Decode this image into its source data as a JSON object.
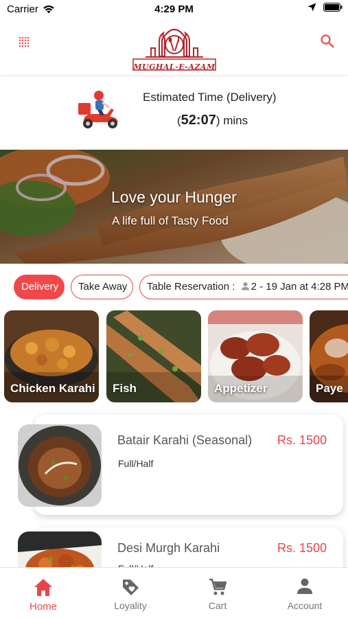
{
  "status_bar": {
    "carrier": "Carrier",
    "time": "4:29 PM"
  },
  "header": {
    "logo_text": "MUGHAL-E-AZAM",
    "menu_icon": "grid-menu-icon",
    "search_icon": "search-icon"
  },
  "eta": {
    "label": "Estimated Time (Delivery)",
    "open_paren": "(",
    "time": "52:07",
    "suffix": ") mins"
  },
  "banner": {
    "title": "Love your Hunger",
    "subtitle": "A life full of Tasty Food"
  },
  "order_types": {
    "delivery": "Delivery",
    "take_away": "Take Away",
    "table_prefix": "Table Reservation : ",
    "table_value": "2 - 19 Jan at 4:28 PM"
  },
  "categories": [
    {
      "label": "Chicken Karahi"
    },
    {
      "label": "Fish"
    },
    {
      "label": "Appetizer"
    },
    {
      "label": "Paye"
    }
  ],
  "menu_items": [
    {
      "name": "Batair Karahi (Seasonal)",
      "price": "Rs.  1500",
      "variant": "Full/Half"
    },
    {
      "name": "Desi Murgh Karahi",
      "price": "Rs.  1500",
      "variant": "Full/Half"
    }
  ],
  "tabs": [
    {
      "label": "Home",
      "icon": "home-icon",
      "active": true
    },
    {
      "label": "Loyality",
      "icon": "tag-icon"
    },
    {
      "label": "Cart",
      "icon": "cart-icon"
    },
    {
      "label": "Account",
      "icon": "person-icon"
    }
  ],
  "colors": {
    "accent": "#e8454a",
    "accent_fill": "#f1474b",
    "logo_red": "#b3262b"
  }
}
